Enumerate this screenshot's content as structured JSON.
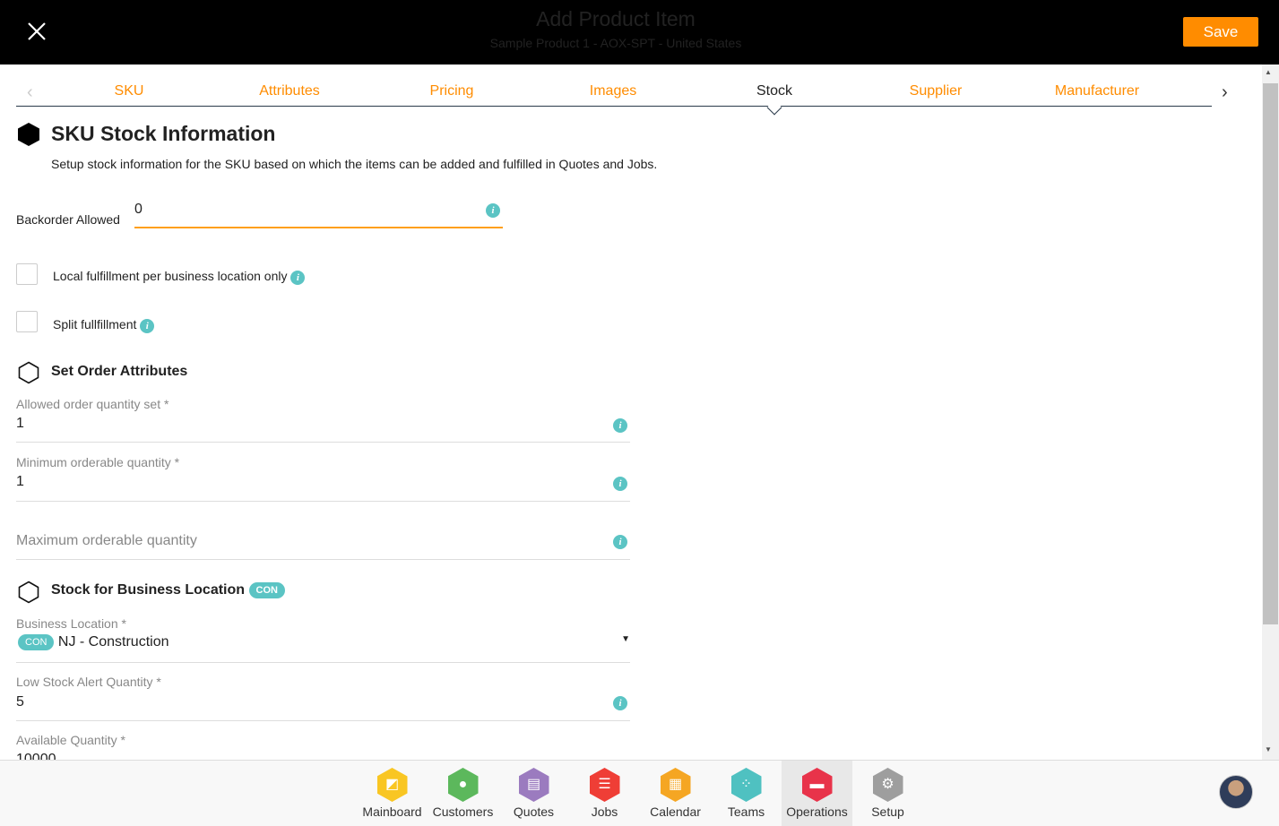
{
  "header": {
    "title": "Add Product Item",
    "subtitle": "Sample Product 1 - AOX-SPT - United States",
    "save_label": "Save"
  },
  "tabs": [
    {
      "label": "SKU"
    },
    {
      "label": "Attributes"
    },
    {
      "label": "Pricing"
    },
    {
      "label": "Images"
    },
    {
      "label": "Stock",
      "active": true
    },
    {
      "label": "Supplier"
    },
    {
      "label": "Manufacturer"
    }
  ],
  "section": {
    "title": "SKU Stock Information",
    "description": "Setup stock information for the SKU based on which the items can be added and fulfilled in Quotes and Jobs."
  },
  "backorder": {
    "label": "Backorder Allowed",
    "value": "0"
  },
  "checkboxes": [
    {
      "label": "Local fulfillment per business location only",
      "checked": false
    },
    {
      "label": "Split fullfillment",
      "checked": false
    }
  ],
  "order_attributes": {
    "title": "Set Order Attributes",
    "fields": [
      {
        "label": "Allowed order quantity set *",
        "value": "1"
      },
      {
        "label": "Minimum orderable quantity *",
        "value": "1"
      },
      {
        "label": "",
        "placeholder": "Maximum orderable quantity",
        "value": ""
      }
    ]
  },
  "stock_location": {
    "title": "Stock for Business Location",
    "badge": "CON",
    "business_location": {
      "label": "Business Location *",
      "badge": "CON",
      "value": "NJ - Construction"
    },
    "low_stock": {
      "label": "Low Stock Alert Quantity *",
      "value": "5"
    },
    "available": {
      "label": "Available Quantity *",
      "value": "10000"
    }
  },
  "nav": [
    {
      "label": "Mainboard",
      "color": "#f9c623",
      "icon": "mainboard-icon"
    },
    {
      "label": "Customers",
      "color": "#5cb85c",
      "icon": "customer-icon"
    },
    {
      "label": "Quotes",
      "color": "#9b7bbf",
      "icon": "quotes-icon"
    },
    {
      "label": "Jobs",
      "color": "#ef3e36",
      "icon": "jobs-icon"
    },
    {
      "label": "Calendar",
      "color": "#f5a623",
      "icon": "calendar-icon"
    },
    {
      "label": "Teams",
      "color": "#4fc1c1",
      "icon": "teams-icon"
    },
    {
      "label": "Operations",
      "color": "#e8334a",
      "icon": "briefcase-icon",
      "active": true
    },
    {
      "label": "Setup",
      "color": "#9e9e9e",
      "icon": "gear-icon"
    }
  ],
  "colors": {
    "accent": "#ff8c00",
    "info": "#5bc4c4",
    "header_bg": "#000000"
  }
}
